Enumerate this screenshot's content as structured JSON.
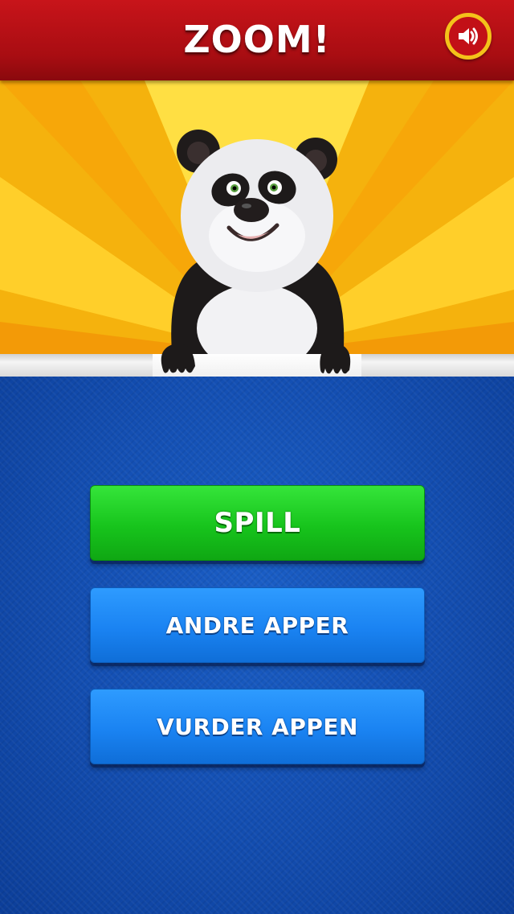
{
  "header": {
    "title": "ZOOM!",
    "sound_icon": "speaker-volume-icon"
  },
  "hero": {
    "character": "panda",
    "colors": {
      "ray_light": "#ffd634",
      "ray_dark": "#f7a70a"
    }
  },
  "menu": {
    "play_label": "SPILL",
    "other_apps_label": "ANDRE APPER",
    "rate_app_label": "VURDER APPEN"
  },
  "colors": {
    "header_red": "#b5111a",
    "sound_ring": "#f4c21a",
    "play_green": "#1ccb21",
    "button_blue": "#1a83f2",
    "panel_blue": "#1450b4"
  }
}
